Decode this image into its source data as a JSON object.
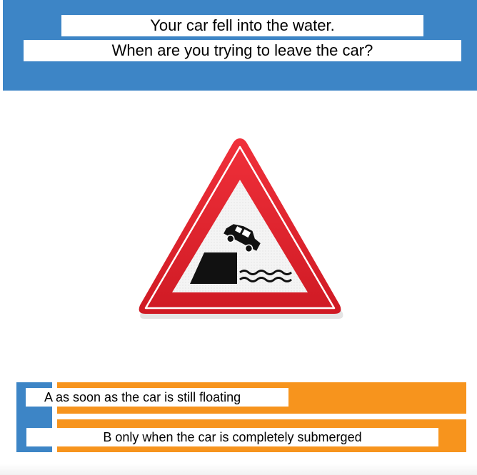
{
  "question": {
    "line1": "Your car fell into the water.",
    "line2": "When are you trying to leave the car?"
  },
  "answers": [
    {
      "text": "A as soon as the car is still floating"
    },
    {
      "text": "B only when the car is completely submerged"
    }
  ],
  "colors": {
    "header_blue": "#3d85c6",
    "answer_orange": "#f7941d",
    "sign_red": "#e1222b"
  },
  "sign": {
    "icon": "car-into-water-warning-sign-icon"
  }
}
